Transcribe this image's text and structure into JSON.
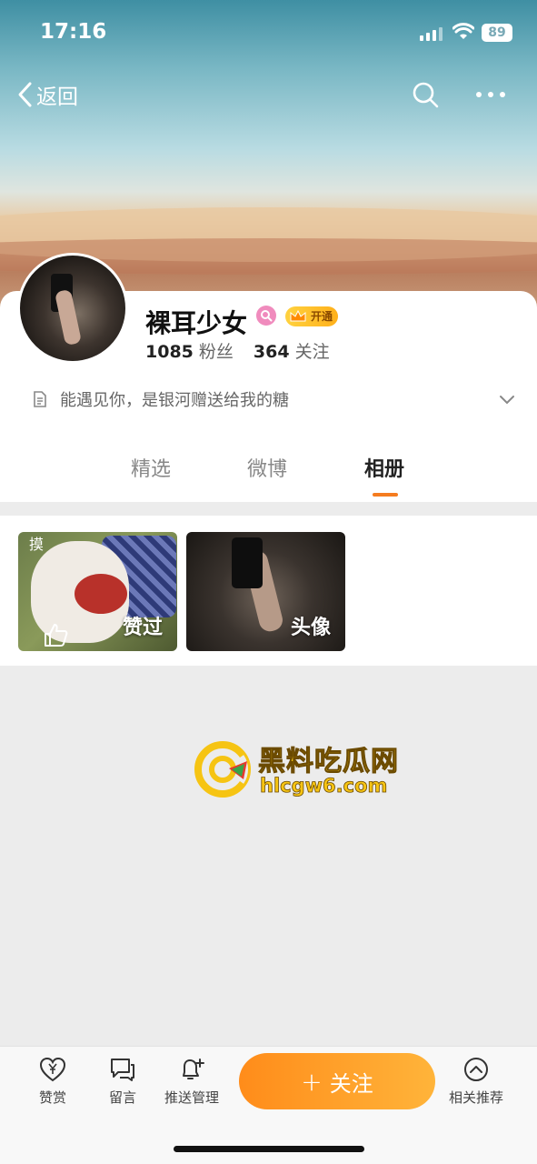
{
  "status_bar": {
    "time": "17:16",
    "battery": "89"
  },
  "nav": {
    "back_label": "返回"
  },
  "profile": {
    "name": "裸耳少女",
    "vip_label": "开通",
    "followers_count": "1085",
    "followers_label": "粉丝",
    "following_count": "364",
    "following_label": "关注",
    "bio": "能遇见你，是银河赠送给我的糖"
  },
  "tabs": [
    {
      "label": "精选"
    },
    {
      "label": "微博"
    },
    {
      "label": "相册"
    }
  ],
  "album": [
    {
      "caption": "赞过",
      "mark": "摸"
    },
    {
      "caption": "头像"
    }
  ],
  "watermark": {
    "title": "黑料吃瓜网",
    "url": "hlcgw6.com"
  },
  "bottom_bar": {
    "reward": "赞赏",
    "message": "留言",
    "push": "推送管理",
    "follow": "关注",
    "related": "相关推荐"
  },
  "colors": {
    "accent": "#f57c1f",
    "follow_gradient_start": "#ff8c1a",
    "follow_gradient_end": "#ffb43a"
  }
}
